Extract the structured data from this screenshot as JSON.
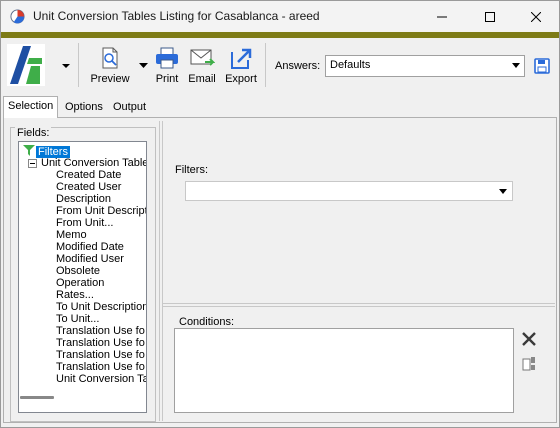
{
  "window": {
    "title": "Unit Conversion Tables Listing for Casablanca - areed",
    "accent_color": "#7d7b16"
  },
  "toolbar": {
    "preview_label": "Preview",
    "print_label": "Print",
    "email_label": "Email",
    "export_label": "Export",
    "answers_label": "Answers:",
    "answers_value": "Defaults"
  },
  "tabs": [
    "Selection",
    "Options",
    "Output"
  ],
  "fields": {
    "label": "Fields:",
    "root": "Filters",
    "group": "Unit Conversion Table",
    "items": [
      "Created Date",
      "Created User",
      "Description",
      "From Unit Descript",
      "From Unit...",
      "Memo",
      "Modified Date",
      "Modified User",
      "Obsolete",
      "Operation",
      "Rates...",
      "To Unit Description",
      "To Unit...",
      "Translation Use fo",
      "Translation Use fo",
      "Translation Use fo",
      "Translation Use fo",
      "Unit Conversion Ta"
    ]
  },
  "filters": {
    "label": "Filters:",
    "value": ""
  },
  "conditions": {
    "label": "Conditions:"
  }
}
